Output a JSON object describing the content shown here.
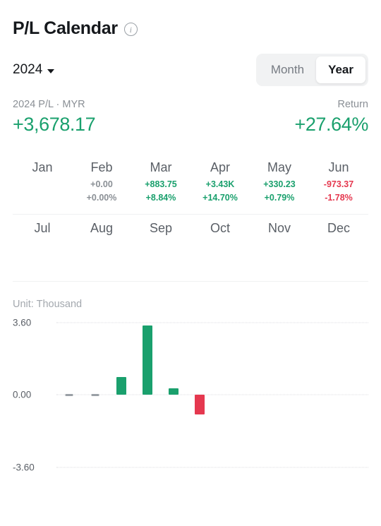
{
  "header": {
    "title": "P/L Calendar",
    "info_icon": "info-circle-icon"
  },
  "controls": {
    "year": "2024",
    "caret": "chevron-down-icon",
    "toggle": {
      "month_label": "Month",
      "year_label": "Year",
      "selected": "Year"
    }
  },
  "summary": {
    "pl_label": "2024 P/L · MYR",
    "pl_value": "+3,678.17",
    "return_label": "Return",
    "return_value": "+27.64%"
  },
  "months": [
    {
      "name": "Jan",
      "pl": "",
      "pct": "",
      "tone": "flat"
    },
    {
      "name": "Feb",
      "pl": "+0.00",
      "pct": "+0.00%",
      "tone": "flat"
    },
    {
      "name": "Mar",
      "pl": "+883.75",
      "pct": "+8.84%",
      "tone": "pos"
    },
    {
      "name": "Apr",
      "pl": "+3.43K",
      "pct": "+14.70%",
      "tone": "pos"
    },
    {
      "name": "May",
      "pl": "+330.23",
      "pct": "+0.79%",
      "tone": "pos"
    },
    {
      "name": "Jun",
      "pl": "-973.37",
      "pct": "-1.78%",
      "tone": "neg"
    },
    {
      "name": "Jul",
      "pl": "",
      "pct": "",
      "tone": "flat"
    },
    {
      "name": "Aug",
      "pl": "",
      "pct": "",
      "tone": "flat"
    },
    {
      "name": "Sep",
      "pl": "",
      "pct": "",
      "tone": "flat"
    },
    {
      "name": "Oct",
      "pl": "",
      "pct": "",
      "tone": "flat"
    },
    {
      "name": "Nov",
      "pl": "",
      "pct": "",
      "tone": "flat"
    },
    {
      "name": "Dec",
      "pl": "",
      "pct": "",
      "tone": "flat"
    }
  ],
  "chart_unit_label": "Unit: Thousand",
  "colors": {
    "positive": "#1aa06d",
    "negative": "#e5384f",
    "neutral": "#9aa0a6",
    "text_primary": "#15181c",
    "text_muted": "#8a8f95",
    "grid": "#dcdee0",
    "toggle_bg": "#f1f2f3"
  },
  "chart_data": {
    "type": "bar",
    "title": "",
    "xlabel": "",
    "ylabel": "",
    "unit": "Thousand",
    "categories": [
      "Jan",
      "Feb",
      "Mar",
      "Apr",
      "May",
      "Jun",
      "Jul",
      "Aug",
      "Sep",
      "Oct",
      "Nov",
      "Dec"
    ],
    "values": [
      0.0,
      0.0,
      0.884,
      3.43,
      0.33,
      -0.973,
      null,
      null,
      null,
      null,
      null,
      null
    ],
    "ylim": [
      -3.6,
      3.6
    ],
    "yticks": [
      3.6,
      0.0,
      -3.6
    ],
    "ytick_labels": [
      "3.60",
      "0.00",
      "-3.60"
    ],
    "grid": true,
    "grid_style": "dotted",
    "legend": false,
    "bar_colors": [
      "#9aa0a6",
      "#9aa0a6",
      "#1aa06d",
      "#1aa06d",
      "#1aa06d",
      "#e5384f",
      null,
      null,
      null,
      null,
      null,
      null
    ]
  }
}
